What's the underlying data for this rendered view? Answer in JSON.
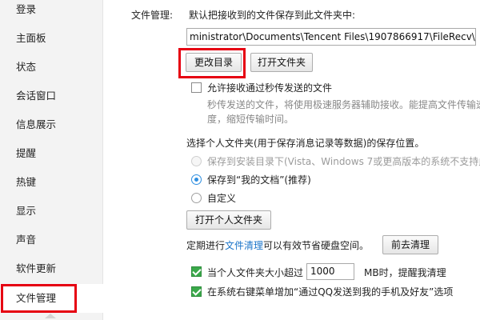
{
  "sidebar": {
    "items": [
      {
        "label": "登录"
      },
      {
        "label": "主面板"
      },
      {
        "label": "状态"
      },
      {
        "label": "会话窗口"
      },
      {
        "label": "信息展示"
      },
      {
        "label": "提醒"
      },
      {
        "label": "热键"
      },
      {
        "label": "显示"
      },
      {
        "label": "声音"
      },
      {
        "label": "软件更新"
      },
      {
        "label": "文件管理"
      }
    ],
    "active_index": 10
  },
  "file_management": {
    "section_label": "文件管理:",
    "save_description": "默认把接收到的文件保存到此文件夹中:",
    "path_value": "ministrator\\Documents\\Tencent Files\\1907866917\\FileRecv\\",
    "change_dir_button": "更改目录",
    "open_folder_button": "打开文件夹",
    "allow_flash_label": "允许接收通过秒传发送的文件",
    "allow_flash_checked": false,
    "flash_help_line1": "秒传发送的文件，将使用极速服务器辅助接收。能提高文件传输速",
    "flash_help_line2": "度，缩短传输时间。",
    "personal_folder_heading": "选择个人文件夹(用于保存消息记录等数据)的保存位置。",
    "options": [
      {
        "label": "保存到安装目录下(Vista、Windows 7或更高版本的系统不支持此",
        "disabled": true,
        "checked": false
      },
      {
        "label": "保存到“我的文档”(推荐)",
        "disabled": false,
        "checked": true
      },
      {
        "label": "自定义",
        "disabled": false,
        "checked": false
      }
    ],
    "open_personal_button": "打开个人文件夹",
    "cleanup_prefix": "定期进行",
    "cleanup_link": "文件清理",
    "cleanup_suffix": "可以有效节省硬盘空间。",
    "cleanup_button": "前去清理",
    "size_alert_prefix": "当个人文件夹大小超过",
    "size_alert_value": "1000",
    "size_alert_suffix": "MB时，提醒我清理",
    "size_alert_checked": true,
    "context_menu_label": "在系统右键菜单增加“通过QQ发送到我的手机及好友”选项",
    "context_menu_checked": true
  },
  "colors": {
    "highlight_red": "#e60012",
    "link_blue": "#1a74c9",
    "check_green": "#3aa94a"
  }
}
